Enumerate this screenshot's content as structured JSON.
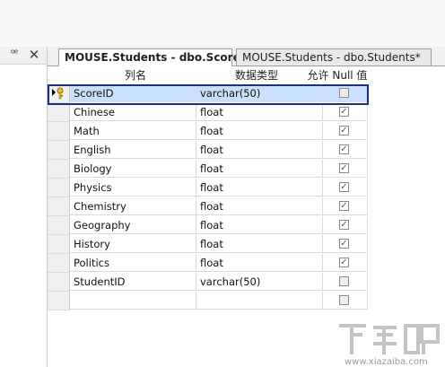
{
  "left_panel": {
    "pin_glyph": "ꟹ",
    "close_glyph": "✕"
  },
  "tabs": [
    {
      "label": "MOUSE.Students - dbo.Score",
      "active": true
    },
    {
      "label": "MOUSE.Students - dbo.Students*",
      "active": false
    }
  ],
  "grid": {
    "headers": [
      "列名",
      "数据类型",
      "允许 Null 值"
    ],
    "rows": [
      {
        "name": "ScoreID",
        "type": "varchar(50)",
        "allow_null": false,
        "primary_key": true,
        "selected": true
      },
      {
        "name": "Chinese",
        "type": "float",
        "allow_null": true
      },
      {
        "name": "Math",
        "type": "float",
        "allow_null": true
      },
      {
        "name": "English",
        "type": "float",
        "allow_null": true
      },
      {
        "name": "Biology",
        "type": "float",
        "allow_null": true
      },
      {
        "name": "Physics",
        "type": "float",
        "allow_null": true
      },
      {
        "name": "Chemistry",
        "type": "float",
        "allow_null": true
      },
      {
        "name": "Geography",
        "type": "float",
        "allow_null": true
      },
      {
        "name": "History",
        "type": "float",
        "allow_null": true
      },
      {
        "name": "Politics",
        "type": "float",
        "allow_null": true
      },
      {
        "name": "StudentID",
        "type": "varchar(50)",
        "allow_null": false
      },
      {
        "name": "",
        "type": "",
        "allow_null": false
      }
    ]
  },
  "watermark": {
    "text": "下载吧",
    "sub": "www.xiazaiba.com"
  },
  "colors": {
    "selection": "#c8e0fb",
    "selection_border": "#1f2d8a",
    "check": "#2b5fa3"
  }
}
